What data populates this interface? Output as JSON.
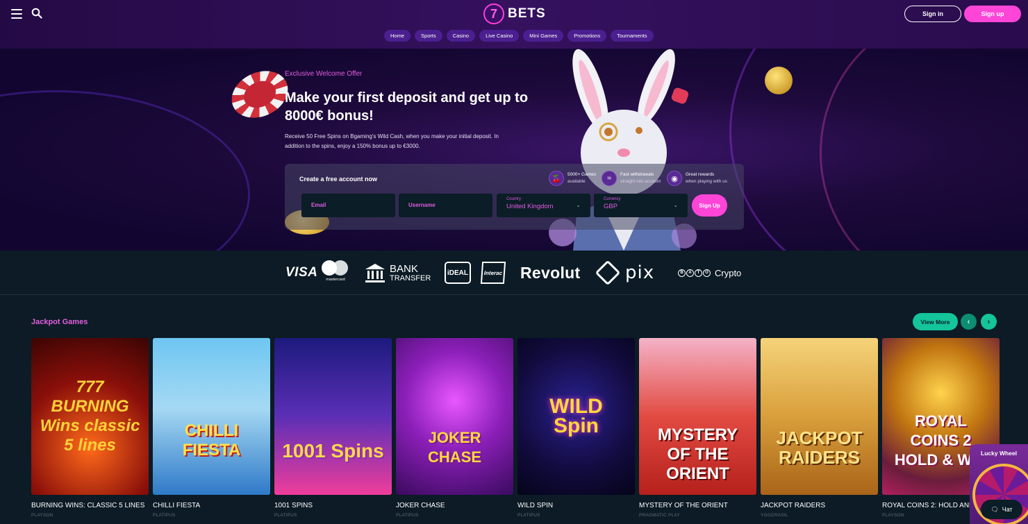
{
  "header": {
    "logo_mark": "7",
    "logo_text": "BETS",
    "signin_label": "Sign in",
    "signup_label": "Sign up",
    "nav": [
      "Home",
      "Sports",
      "Casino",
      "Live Casino",
      "Mini Games",
      "Promotions",
      "Tournaments"
    ]
  },
  "hero": {
    "eyebrow": "Exclusive Welcome Offer",
    "title": "Make your first deposit and get up to 8000€ bonus!",
    "description": "Receive 50 Free Spins on Bgaming's Wild Cash, when you make your initial deposit. In addition to the spins, enjoy a 150% bonus up to €3000.",
    "panel_title": "Create a free account now",
    "perks": [
      {
        "title": "5000+ Games",
        "subtitle": "available",
        "icon": "cherry-icon"
      },
      {
        "title": "Fast withdrawals",
        "subtitle": "straight into account",
        "icon": "cash-icon"
      },
      {
        "title": "Great rewards",
        "subtitle": "when playing with us",
        "icon": "medal-icon"
      }
    ],
    "form": {
      "email_label": "Email",
      "username_label": "Username",
      "country_label": "Country",
      "country_value": "United Kingdom",
      "currency_label": "Currency",
      "currency_value": "GBP",
      "submit_label": "Sign Up"
    }
  },
  "payments": {
    "visa": "VISA",
    "mastercard": "mastercard",
    "bank_line1": "BANK",
    "bank_line2": "TRANSFER",
    "ideal": "iDEAL",
    "interac": "Interac",
    "revolut": "Revolut",
    "pix": "pix",
    "crypto_badges": [
      "B",
      "A",
      "T",
      "O"
    ],
    "crypto": "Crypto"
  },
  "jackpot": {
    "title": "Jackpot Games",
    "view_more_label": "View More",
    "prev_icon": "chevron-left-icon",
    "next_icon": "chevron-right-icon",
    "games": [
      {
        "name": "BURNING WINS: CLASSIC 5 LINES",
        "provider": "PLAYSON",
        "art": "777 BURNING Wins classic 5 lines"
      },
      {
        "name": "CHILLI FIESTA",
        "provider": "PLATIPUS",
        "art": "CHILLI FIESTA"
      },
      {
        "name": "1001 SPINS",
        "provider": "PLATIPUS",
        "art": "1001 Spins"
      },
      {
        "name": "JOKER CHASE",
        "provider": "PLATIPUS",
        "art": "JOKER CHASE"
      },
      {
        "name": "WILD SPIN",
        "provider": "PLATIPUS",
        "art": "WILD Spin"
      },
      {
        "name": "MYSTERY OF THE ORIENT",
        "provider": "PRAGMATIC PLAY",
        "art": "MYSTERY OF THE ORIENT"
      },
      {
        "name": "JACKPOT RAIDERS",
        "provider": "YGGDRASIL",
        "art": "JACKPOT RAIDERS"
      },
      {
        "name": "ROYAL COINS 2: HOLD AND WIN",
        "provider": "PLAYSON",
        "art": "ROYAL COINS 2 HOLD & WIN"
      }
    ]
  },
  "widgets": {
    "lucky_wheel_label": "Lucky Wheel",
    "chat_label": "Чат"
  }
}
